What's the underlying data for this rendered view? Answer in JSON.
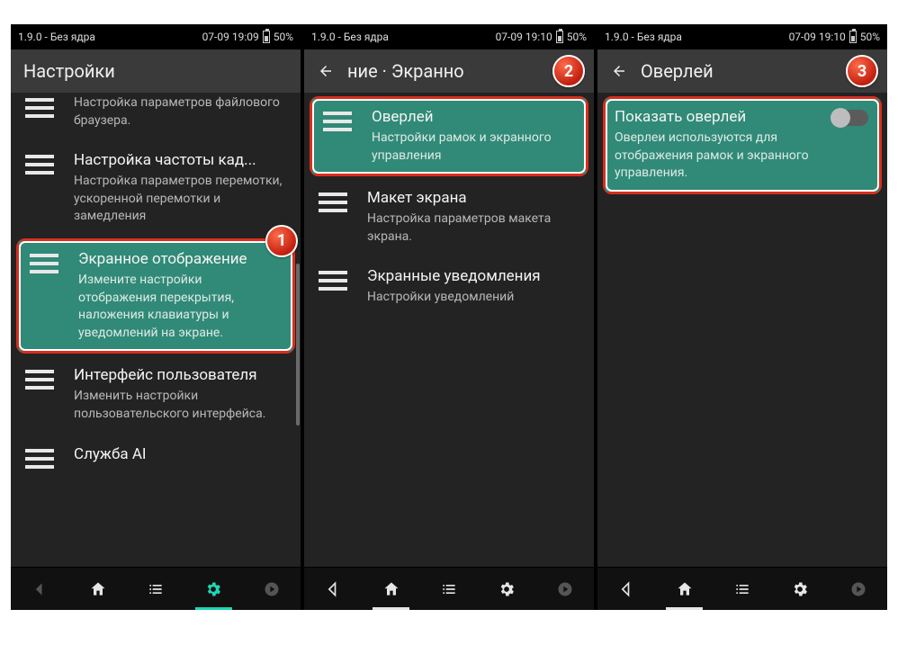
{
  "status": {
    "version": "1.9.0 - Без ядра",
    "time1": "07-09 19:09",
    "time2": "07-09 19:10",
    "battery": "50%"
  },
  "screen1": {
    "title": "Настройки",
    "items": [
      {
        "title": "",
        "desc": "Настройка параметров файлового браузера."
      },
      {
        "title": "Настройка частоты кад...",
        "desc": "Настройка параметров перемотки, ускоренной перемотки и замедления"
      },
      {
        "title": "Экранное отображение",
        "desc": "Измените настройки отображения перекрытия, наложения клавиатуры и уведомлений на экране."
      },
      {
        "title": "Интерфейс пользователя",
        "desc": "Изменить настройки пользовательского интерфейса."
      },
      {
        "title": "Служба AI",
        "desc": ""
      }
    ],
    "badge": "1"
  },
  "screen2": {
    "title": "ние    ·    Экранно",
    "items": [
      {
        "title": "Оверлей",
        "desc": "Настройки рамок и экранного управления"
      },
      {
        "title": "Макет экрана",
        "desc": "Настройка параметров макета экрана."
      },
      {
        "title": "Экранные уведомления",
        "desc": "Настройки уведомлений"
      }
    ],
    "badge": "2"
  },
  "screen3": {
    "title": "Оверлей",
    "item": {
      "title": "Показать оверлей",
      "desc": "Оверлеи используются для отображения рамок и экранного управления."
    },
    "badge": "3"
  }
}
